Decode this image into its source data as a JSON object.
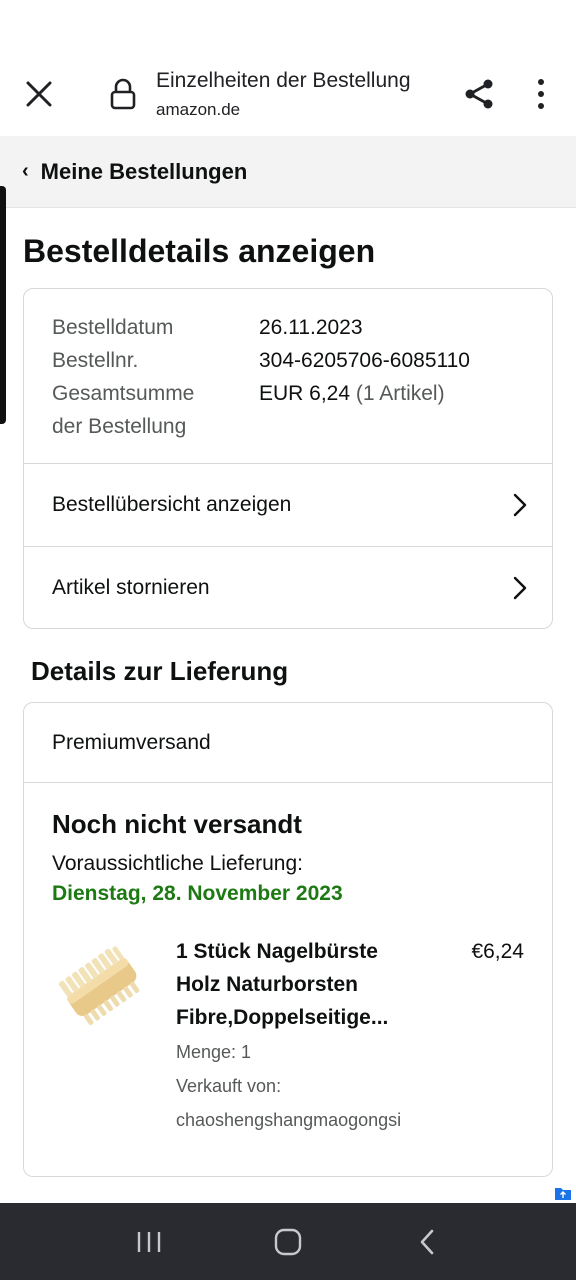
{
  "browser": {
    "title": "Einzelheiten der Bestellung",
    "url": "amazon.de"
  },
  "breadcrumb": {
    "back_label": "Meine Bestellungen"
  },
  "page": {
    "title": "Bestelldetails anzeigen"
  },
  "order": {
    "rows": [
      {
        "label": "Bestelldatum",
        "value": "26.11.2023"
      },
      {
        "label": "Bestellnr.",
        "value": "304-6205706-6085110"
      }
    ],
    "total_label_line1": "Gesamtsumme",
    "total_label_line2": "der Bestellung",
    "total_value": "EUR 6,24",
    "total_items": "(1 Artikel)",
    "links": [
      {
        "label": "Bestellübersicht anzeigen"
      },
      {
        "label": "Artikel stornieren"
      }
    ]
  },
  "delivery": {
    "section_title": "Details zur Lieferung",
    "shipping_method": "Premiumversand",
    "status": "Noch nicht versandt",
    "eta_label": "Voraussichtliche Lieferung:",
    "eta_date": "Dienstag, 28. November 2023",
    "eta_color": "#1d7a12",
    "item": {
      "title": "1 Stück Nagelbürste Holz Naturborsten Fibre,Doppelseitige...",
      "price": "€6,24",
      "quantity": "Menge: 1",
      "sold_by_label": "Verkauft von:",
      "seller": "chaoshengshangmaogongsi",
      "image_icon": "nail-brush-image"
    }
  },
  "icons": {
    "close": "close-icon",
    "lock": "lock-icon",
    "share": "share-icon",
    "more": "more-vertical-icon",
    "chevron_right": "chevron-right-icon",
    "nav_recent": "recent-apps-icon",
    "nav_home": "home-icon",
    "nav_back": "back-icon"
  }
}
